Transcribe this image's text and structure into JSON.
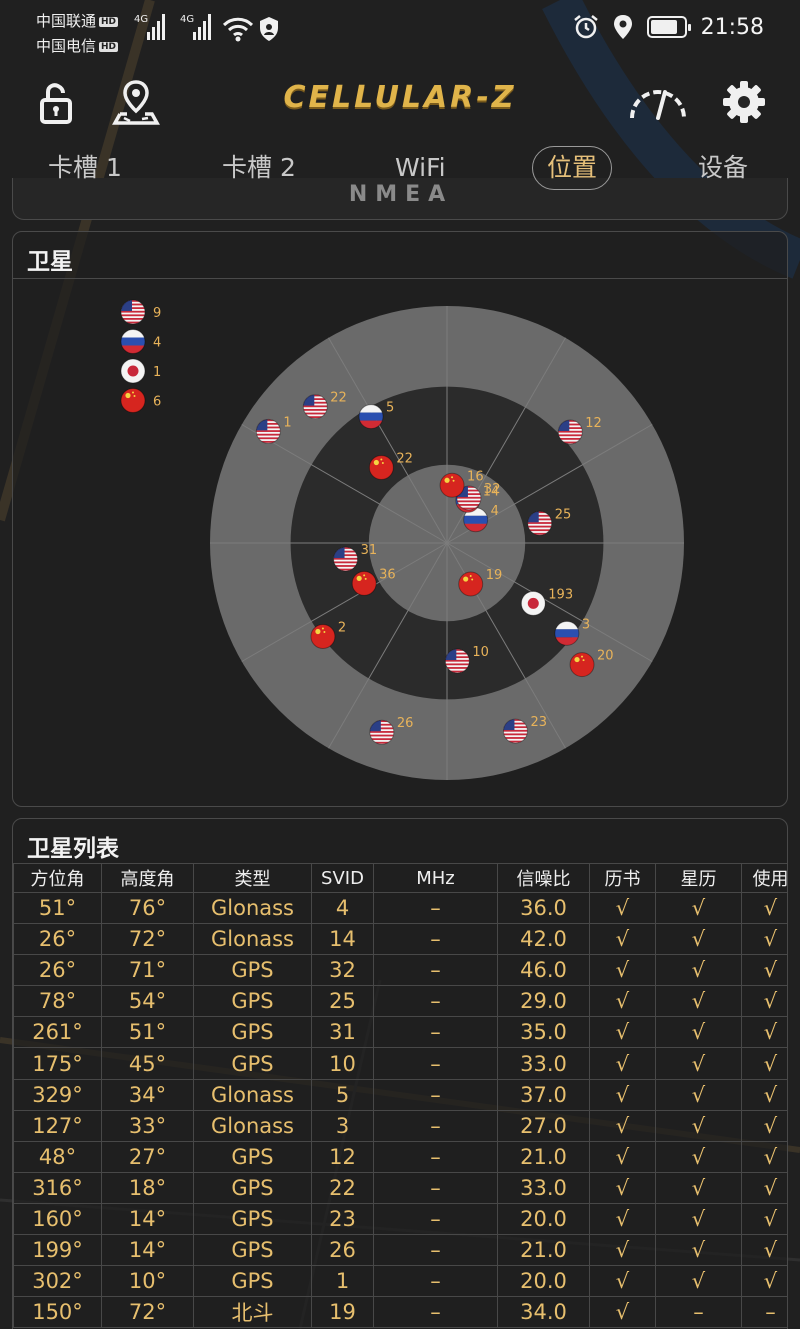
{
  "status_bar": {
    "carrier1": "中国联通",
    "carrier2": "中国电信",
    "hd_badge": "HD",
    "network": "4G",
    "time": "21:58",
    "battery_level": 0.8
  },
  "app": {
    "title": "CELLULAR-Z",
    "icons": [
      "lock-icon",
      "map-location-icon",
      "speedometer-icon",
      "gear-icon"
    ]
  },
  "tabs": [
    {
      "label": "卡槽 1"
    },
    {
      "label": "卡槽 2"
    },
    {
      "label": "WiFi"
    },
    {
      "label": "位置",
      "active": true
    },
    {
      "label": "设备"
    }
  ],
  "nmea_label": "NMEA",
  "satellites_panel": {
    "title": "卫星",
    "legend": [
      {
        "constellation": "GPS",
        "flag": "us",
        "count": "9"
      },
      {
        "constellation": "Glonass",
        "flag": "ru",
        "count": "4"
      },
      {
        "constellation": "QZSS",
        "flag": "jp",
        "count": "1"
      },
      {
        "constellation": "北斗",
        "flag": "cn",
        "count": "6"
      }
    ],
    "colors": {
      "ring": "#6a6a6a",
      "disc": "#2b2b2b",
      "label": "#e8b35a"
    },
    "satellites": [
      {
        "svid": "4",
        "flag": "ru",
        "azimuth": 51,
        "elevation": 76
      },
      {
        "svid": "14",
        "flag": "ru",
        "azimuth": 26,
        "elevation": 72
      },
      {
        "svid": "32",
        "flag": "us",
        "azimuth": 26,
        "elevation": 71
      },
      {
        "svid": "25",
        "flag": "us",
        "azimuth": 78,
        "elevation": 54
      },
      {
        "svid": "31",
        "flag": "us",
        "azimuth": 261,
        "elevation": 51
      },
      {
        "svid": "10",
        "flag": "us",
        "azimuth": 175,
        "elevation": 45
      },
      {
        "svid": "5",
        "flag": "ru",
        "azimuth": 329,
        "elevation": 34
      },
      {
        "svid": "3",
        "flag": "ru",
        "azimuth": 127,
        "elevation": 33
      },
      {
        "svid": "12",
        "flag": "us",
        "azimuth": 48,
        "elevation": 27
      },
      {
        "svid": "22",
        "flag": "us",
        "azimuth": 316,
        "elevation": 18
      },
      {
        "svid": "23",
        "flag": "us",
        "azimuth": 160,
        "elevation": 14
      },
      {
        "svid": "26",
        "flag": "us",
        "azimuth": 199,
        "elevation": 14
      },
      {
        "svid": "1",
        "flag": "us",
        "azimuth": 302,
        "elevation": 10
      },
      {
        "svid": "19",
        "flag": "cn",
        "azimuth": 150,
        "elevation": 72
      },
      {
        "svid": "16",
        "flag": "cn",
        "azimuth": 5,
        "elevation": 68
      },
      {
        "svid": "36",
        "flag": "cn",
        "azimuth": 244,
        "elevation": 55
      },
      {
        "svid": "22",
        "flag": "cn",
        "azimuth": 319,
        "elevation": 52
      },
      {
        "svid": "2",
        "flag": "cn",
        "azimuth": 233,
        "elevation": 31
      },
      {
        "svid": "20",
        "flag": "cn",
        "azimuth": 132,
        "elevation": 21
      },
      {
        "svid": "193",
        "flag": "jp",
        "azimuth": 125,
        "elevation": 50
      }
    ]
  },
  "satellite_list": {
    "title": "卫星列表",
    "columns": [
      "方位角",
      "高度角",
      "类型",
      "SVID",
      "MHz",
      "信噪比",
      "历书",
      "星历",
      "使用"
    ],
    "rows": [
      [
        "51°",
        "76°",
        "Glonass",
        "4",
        "–",
        "36.0",
        "√",
        "√",
        "√"
      ],
      [
        "26°",
        "72°",
        "Glonass",
        "14",
        "–",
        "42.0",
        "√",
        "√",
        "√"
      ],
      [
        "26°",
        "71°",
        "GPS",
        "32",
        "–",
        "46.0",
        "√",
        "√",
        "√"
      ],
      [
        "78°",
        "54°",
        "GPS",
        "25",
        "–",
        "29.0",
        "√",
        "√",
        "√"
      ],
      [
        "261°",
        "51°",
        "GPS",
        "31",
        "–",
        "35.0",
        "√",
        "√",
        "√"
      ],
      [
        "175°",
        "45°",
        "GPS",
        "10",
        "–",
        "33.0",
        "√",
        "√",
        "√"
      ],
      [
        "329°",
        "34°",
        "Glonass",
        "5",
        "–",
        "37.0",
        "√",
        "√",
        "√"
      ],
      [
        "127°",
        "33°",
        "Glonass",
        "3",
        "–",
        "27.0",
        "√",
        "√",
        "√"
      ],
      [
        "48°",
        "27°",
        "GPS",
        "12",
        "–",
        "21.0",
        "√",
        "√",
        "√"
      ],
      [
        "316°",
        "18°",
        "GPS",
        "22",
        "–",
        "33.0",
        "√",
        "√",
        "√"
      ],
      [
        "160°",
        "14°",
        "GPS",
        "23",
        "–",
        "20.0",
        "√",
        "√",
        "√"
      ],
      [
        "199°",
        "14°",
        "GPS",
        "26",
        "–",
        "21.0",
        "√",
        "√",
        "√"
      ],
      [
        "302°",
        "10°",
        "GPS",
        "1",
        "–",
        "20.0",
        "√",
        "√",
        "√"
      ],
      [
        "150°",
        "72°",
        "北斗",
        "19",
        "–",
        "34.0",
        "√",
        "–",
        "–"
      ]
    ]
  }
}
